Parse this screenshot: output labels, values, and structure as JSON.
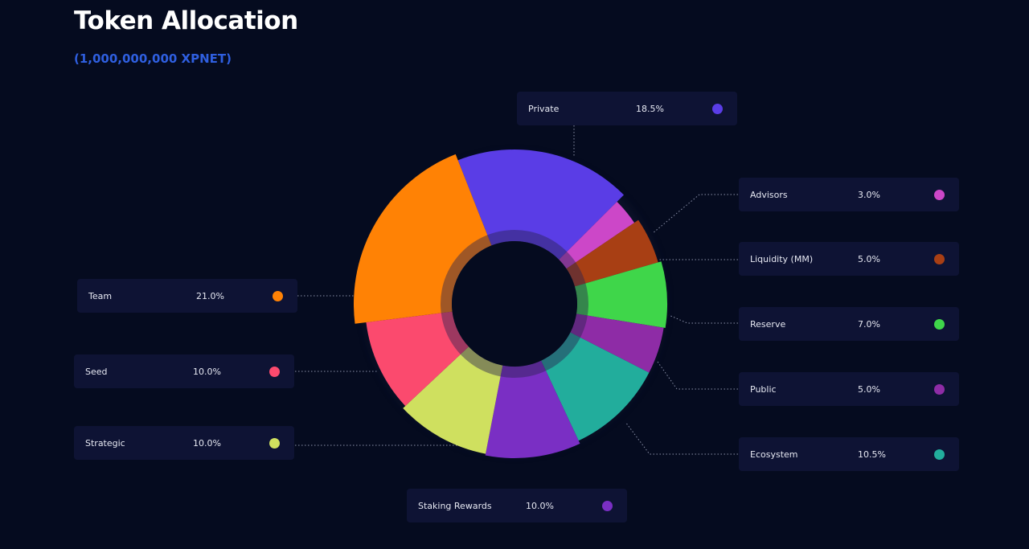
{
  "header": {
    "title": "Token Allocation",
    "subtitle": "(1,000,000,000 XPNET)"
  },
  "chart_data": {
    "type": "pie",
    "style": "donut",
    "title": "Token Allocation",
    "subtitle": "(1,000,000,000 XPNET)",
    "unit": "%",
    "slices": [
      {
        "label": "Private",
        "value": 18.5,
        "display": "18.5%",
        "color": "#5a3de6"
      },
      {
        "label": "Advisors",
        "value": 3.0,
        "display": "3.0%",
        "color": "#cc47c8"
      },
      {
        "label": "Liquidity (MM)",
        "value": 5.0,
        "display": "5.0%",
        "color": "#a83f14"
      },
      {
        "label": "Reserve",
        "value": 7.0,
        "display": "7.0%",
        "color": "#3fd64a"
      },
      {
        "label": "Public",
        "value": 5.0,
        "display": "5.0%",
        "color": "#8e2ca6"
      },
      {
        "label": "Ecosystem",
        "value": 10.5,
        "display": "10.5%",
        "color": "#22ad9c"
      },
      {
        "label": "Staking Rewards",
        "value": 10.0,
        "display": "10.0%",
        "color": "#7a2fc4"
      },
      {
        "label": "Strategic",
        "value": 10.0,
        "display": "10.0%",
        "color": "#cfe05f"
      },
      {
        "label": "Seed",
        "value": 10.0,
        "display": "10.0%",
        "color": "#fb4a6e"
      },
      {
        "label": "Team",
        "value": 21.0,
        "display": "21.0%",
        "color": "#ff8205"
      }
    ],
    "legend_placement": "around-chart-with-leader-lines"
  }
}
